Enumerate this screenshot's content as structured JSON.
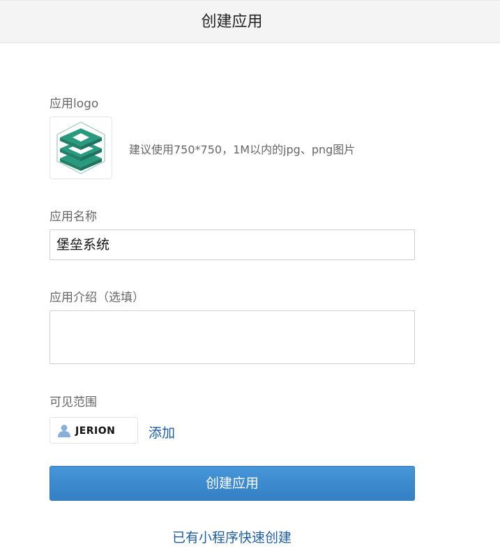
{
  "header": {
    "title": "创建应用"
  },
  "form": {
    "logo_label": "应用logo",
    "logo_hint": "建议使用750*750，1M以内的jpg、png图片",
    "name_label": "应用名称",
    "name_value": "堡垒系统",
    "desc_label": "应用介绍（选填）",
    "desc_value": "",
    "scope_label": "可见范围",
    "member_name": "JERION",
    "add_label": "添加",
    "submit_label": "创建应用",
    "quick_create_label": "已有小程序快速创建"
  },
  "colors": {
    "logo_green": "#2a9a7e",
    "primary_button": "#3f8bd0",
    "link": "#1f5c9c"
  },
  "icons": {
    "logo": "app-logo-icon",
    "member": "user-avatar-icon"
  }
}
